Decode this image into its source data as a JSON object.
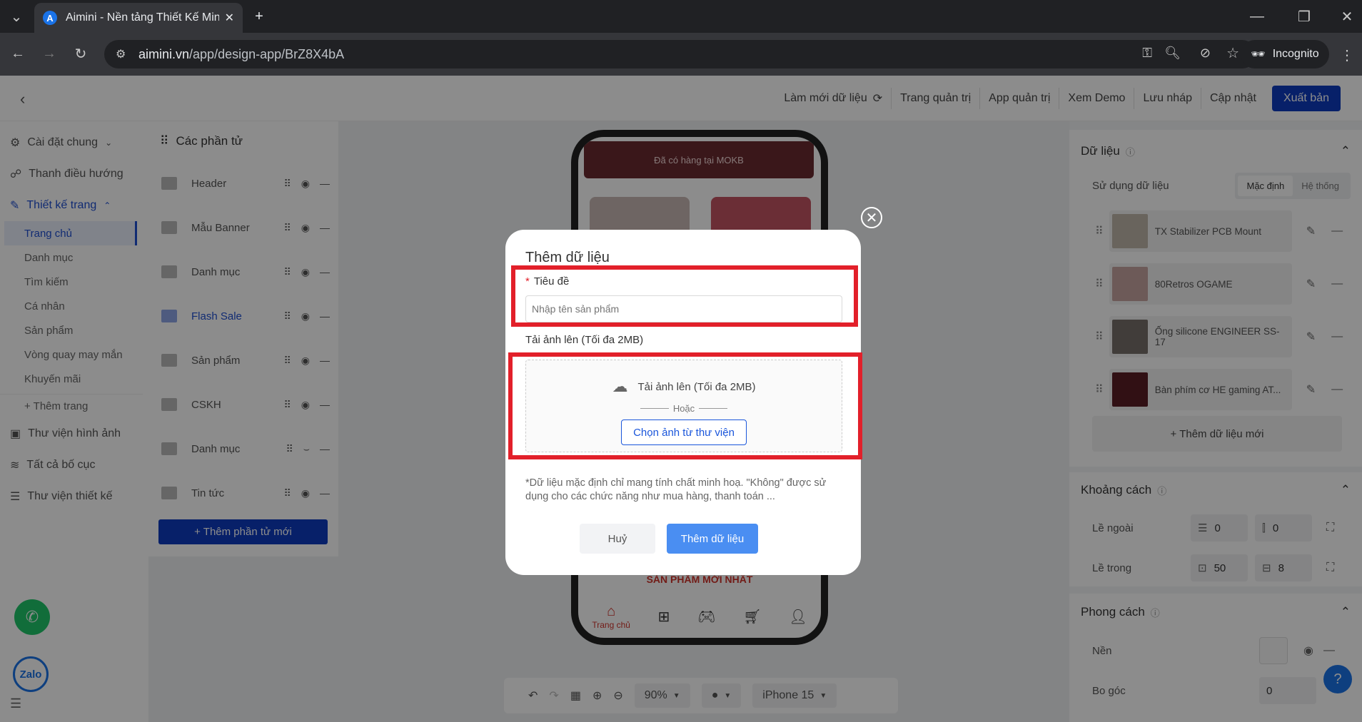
{
  "browser": {
    "tab_title": "Aimini - Nền tảng Thiết Kế Mini",
    "favicon_letter": "A",
    "url_host": "aimini.vn",
    "url_path": "/app/design-app/BrZ8X4bA",
    "incognito_label": "Incognito"
  },
  "topnav": {
    "refresh": "Làm mới dữ liệu",
    "admin_page": "Trang quản trị",
    "admin_app": "App quản trị",
    "demo": "Xem Demo",
    "draft": "Lưu nháp",
    "update": "Cập nhật",
    "publish": "Xuất bản"
  },
  "sidebar": {
    "general": "Cài đặt chung",
    "navbar": "Thanh điều hướng",
    "page_design": "Thiết kế trang",
    "pages": [
      "Trang chủ",
      "Danh mục",
      "Tìm kiếm",
      "Cá nhân",
      "Sản phẩm",
      "Vòng quay may mắn",
      "Khuyến mãi"
    ],
    "add_page": "+ Thêm trang",
    "image_lib": "Thư viện hình ảnh",
    "layouts": "Tất cả bố cục",
    "design_lib": "Thư viện thiết kế"
  },
  "elements": {
    "title": "Các phần tử",
    "items": [
      "Header",
      "Mẫu Banner",
      "Danh mục",
      "Flash Sale",
      "Sản phẩm",
      "CSKH",
      "Danh mục",
      "Tin tức"
    ],
    "add_button": "+ Thêm phần tử mới"
  },
  "phone": {
    "banner_text": "Đã có hàng tại MOKB",
    "section_title": "SẢN PHẨM MỚI NHẤT",
    "home_label": "Trang chủ"
  },
  "right_panel": {
    "data_title": "Dữ liệu",
    "use_data": "Sử dụng dữ liệu",
    "seg_default": "Mặc định",
    "seg_system": "Hệ thống",
    "items": [
      "TX Stabilizer PCB Mount",
      "80Retros OGAME",
      "Ống silicone ENGINEER SS-17",
      "Bàn phím cơ HE gaming AT..."
    ],
    "add_data": "+ Thêm dữ liệu mới",
    "spacing_title": "Khoảng cách",
    "outer": "Lề ngoài",
    "inner": "Lề trong",
    "outer_v": "0",
    "outer_h": "0",
    "inner_v": "50",
    "inner_h": "8",
    "style_title": "Phong cách",
    "background": "Nền",
    "radius": "Bo góc",
    "radius_value": "0"
  },
  "toolbar": {
    "zoom": "90%",
    "device": "iPhone 15"
  },
  "modal": {
    "title": "Thêm dữ liệu",
    "required_mark": "*",
    "field_label": "Tiêu đề",
    "field_placeholder": "Nhập tên sản phẩm",
    "upload_label": "Tải ảnh lên (Tối đa 2MB)",
    "upload_drop": "Tải ảnh lên (Tối đa 2MB)",
    "or": "Hoặc",
    "choose_library": "Chọn ảnh từ thư viện",
    "note": "*Dữ liệu mặc định chỉ mang tính chất minh hoạ. \"Không\" được sử dụng cho các chức năng như mua hàng, thanh toán ...",
    "cancel": "Huỷ",
    "submit": "Thêm dữ liệu"
  },
  "floats": {
    "zalo": "Zalo",
    "help": "?"
  },
  "colors": {
    "primary": "#0d3bbf",
    "highlight_red": "#e2202a",
    "call_green": "#1fc76a"
  }
}
